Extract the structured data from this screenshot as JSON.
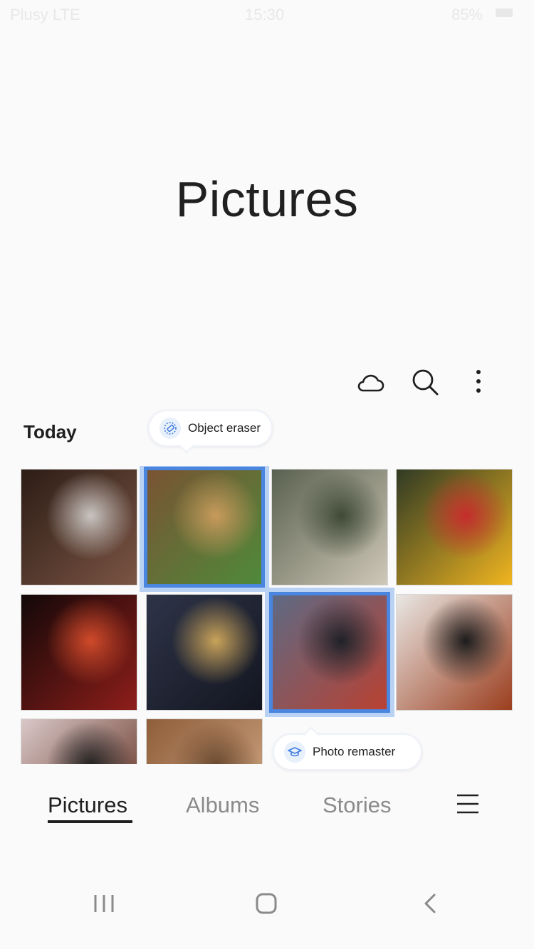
{
  "status_bar": {
    "carrier": "Plusy LTE",
    "time": "15:30",
    "battery": "85%"
  },
  "header": {
    "title": "Pictures"
  },
  "toolbar": {
    "icons": [
      "cloud-icon",
      "search-icon",
      "more-vertical-icon"
    ]
  },
  "section": {
    "title": "Today"
  },
  "tooltips": {
    "object_eraser": {
      "label": "Object eraser",
      "icon": "eraser-icon"
    },
    "photo_remaster": {
      "label": "Photo remaster",
      "icon": "graduation-cap-icon"
    }
  },
  "photos": [
    {
      "name": "photo-eye-closeup",
      "selected": false,
      "colors": [
        "#2c1d16",
        "#7b5444",
        "#c9c4c0"
      ]
    },
    {
      "name": "photo-food-plate",
      "selected": true,
      "colors": [
        "#7a5333",
        "#4e8a3a",
        "#c89a5c"
      ]
    },
    {
      "name": "photo-friends-cafe",
      "selected": false,
      "colors": [
        "#5a6150",
        "#cfc8b8",
        "#3f4a36"
      ]
    },
    {
      "name": "photo-drinks",
      "selected": false,
      "colors": [
        "#2f3a24",
        "#f0b520",
        "#c62d2d"
      ]
    },
    {
      "name": "photo-red-leaves-night",
      "selected": false,
      "colors": [
        "#120808",
        "#8e1e1a",
        "#d04a2a"
      ]
    },
    {
      "name": "photo-city-night-silhouette",
      "selected": false,
      "colors": [
        "#2e3448",
        "#131620",
        "#c9a35a"
      ]
    },
    {
      "name": "photo-young-man-portrait",
      "selected": true,
      "colors": [
        "#5d6a84",
        "#b94132",
        "#1f2228"
      ]
    },
    {
      "name": "photo-woman-curly-hair",
      "selected": false,
      "colors": [
        "#e9e7e4",
        "#9b3e1e",
        "#1c1c1c"
      ]
    },
    {
      "name": "photo-woman-sunset",
      "selected": false,
      "colors": [
        "#d9c8c8",
        "#5a2414",
        "#222222"
      ]
    },
    {
      "name": "photo-dog",
      "selected": false,
      "colors": [
        "#8f5d3a",
        "#d8b08c",
        "#6b4a30"
      ]
    }
  ],
  "tabs": [
    {
      "label": "Pictures",
      "active": true
    },
    {
      "label": "Albums",
      "active": false
    },
    {
      "label": "Stories",
      "active": false
    }
  ],
  "accent_color": "#4a86e0"
}
